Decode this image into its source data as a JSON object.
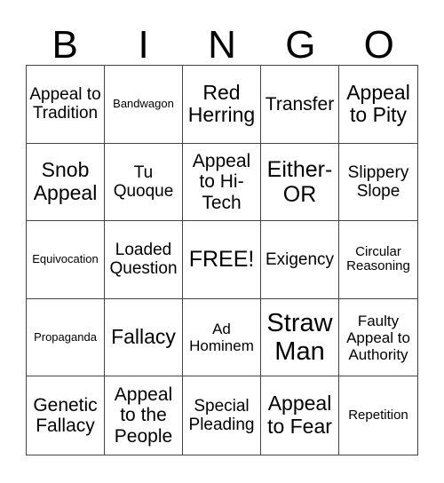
{
  "header": [
    "B",
    "I",
    "N",
    "G",
    "O"
  ],
  "cells": [
    "Appeal to Tradition",
    "Bandwagon",
    "Red Herring",
    "Transfer",
    "Appeal to Pity",
    "Snob Appeal",
    "Tu Quoque",
    "Appeal to Hi-Tech",
    "Either-OR",
    "Slippery Slope",
    "Equivocation",
    "Loaded Question",
    "FREE!",
    "Exigency",
    "Circular Reasoning",
    "Propaganda",
    "Fallacy",
    "Ad Hominem",
    "Straw Man",
    "Faulty Appeal to Authority",
    "Genetic Fallacy",
    "Appeal to the People",
    "Special Pleading",
    "Appeal to Fear",
    "Repetition"
  ]
}
